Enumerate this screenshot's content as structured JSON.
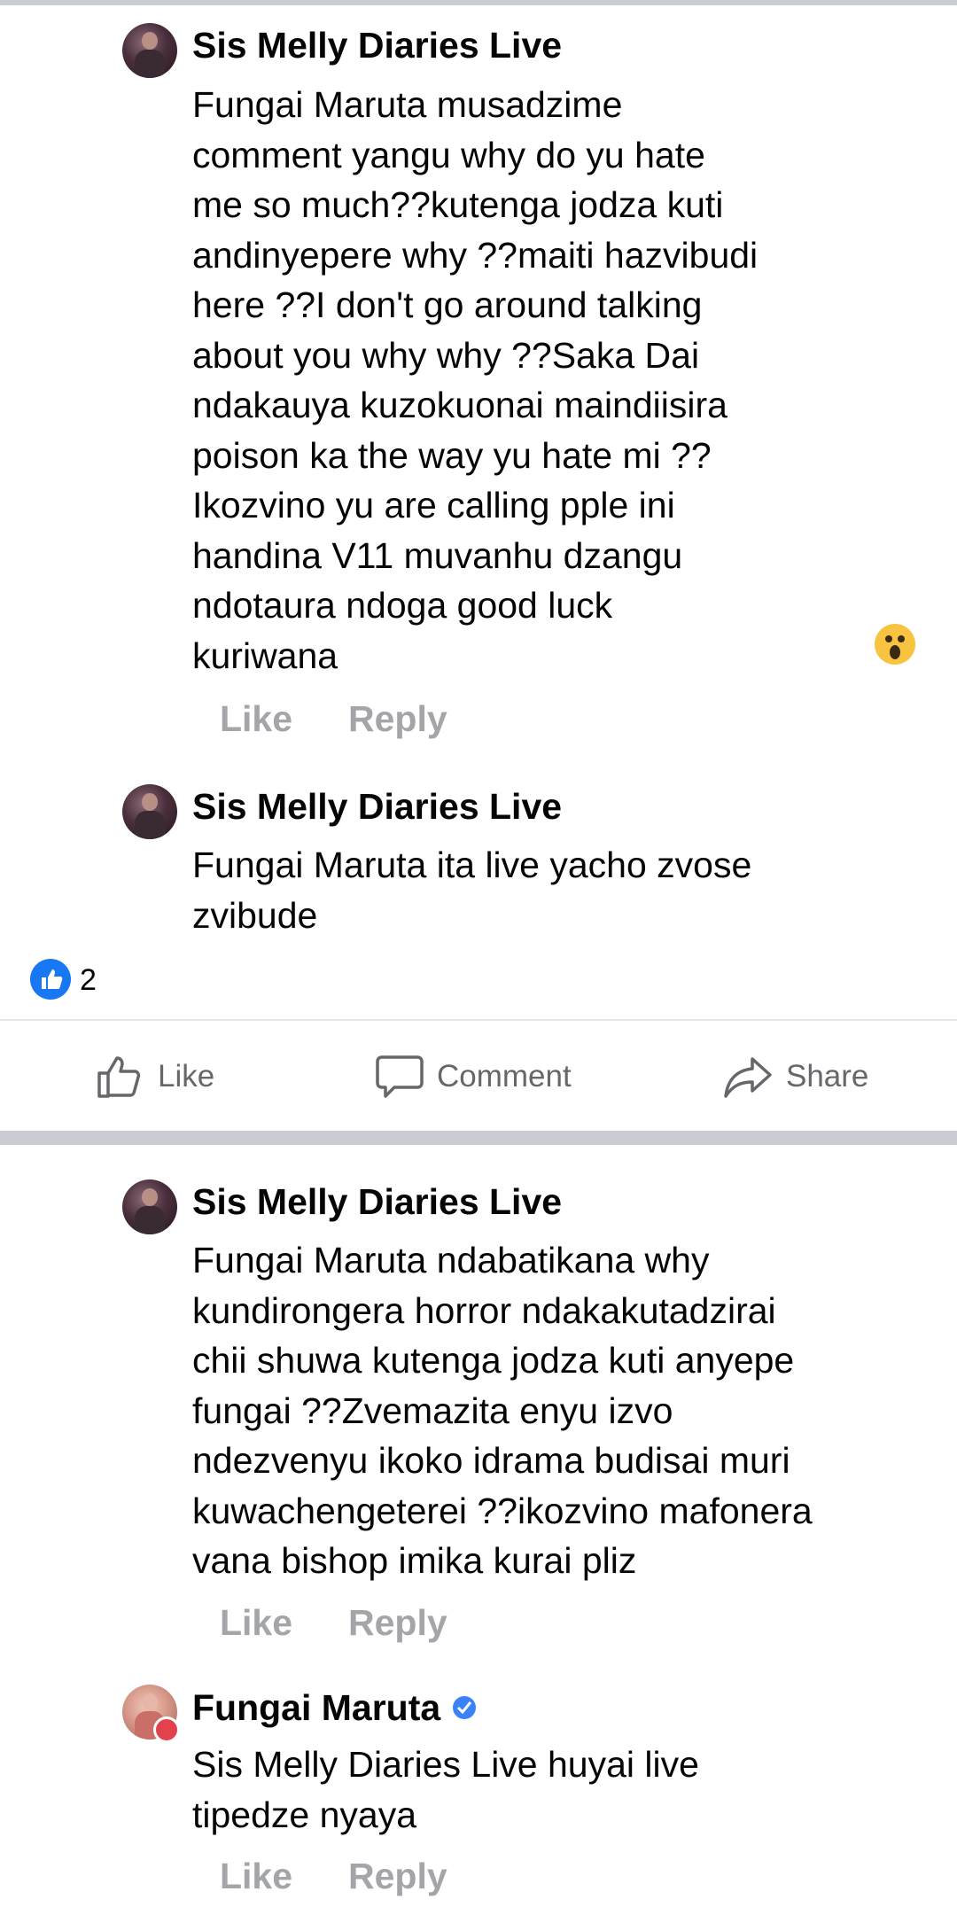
{
  "comments_top": [
    {
      "author": "Sis Melly Diaries Live",
      "text": "Fungai Maruta musadzime\ncomment yangu why do yu hate\nme so much??kutenga jodza kuti\nandinyepere why ??maiti hazvibudi\nhere ??I don't go around talking\nabout you why why ??Saka Dai\nndakauya kuzokuonai maindiisira\npoison ka the way yu hate mi ??\nIkozvino yu are calling pple ini\nhandina V11 muvanhu dzangu\nndotaura ndoga good luck\nkuriwana",
      "like": "Like",
      "reply": "Reply"
    },
    {
      "author": "Sis Melly Diaries Live",
      "text": "Fungai Maruta ita live yacho zvose\nzvibude"
    }
  ],
  "post": {
    "reaction_count": "2",
    "like_label": "Like",
    "comment_label": "Comment",
    "share_label": "Share"
  },
  "comments_bottom": [
    {
      "author": "Sis Melly Diaries Live",
      "text": "Fungai Maruta ndabatikana why\nkundirongera horror ndakakutadzirai\nchii shuwa kutenga jodza kuti anyepe\nfungai ??Zvemazita enyu izvo\nndezvenyu ikoko idrama budisai muri\nkuwachengeterei ??ikozvino mafonera\nvana bishop imika kurai pliz",
      "like": "Like",
      "reply": "Reply"
    },
    {
      "author": "Fungai Maruta",
      "text": "Sis Melly Diaries Live huyai live\ntipedze nyaya",
      "like": "Like",
      "reply": "Reply"
    }
  ],
  "colors": {
    "brand_blue": "#1877f2",
    "muted_action": "#a3a5a9",
    "separator": "#c9ccd1"
  },
  "icons": [
    "like-thumb-icon",
    "comment-bubble-icon",
    "share-arrow-icon",
    "verified-check-icon",
    "wow-emoji-icon"
  ]
}
